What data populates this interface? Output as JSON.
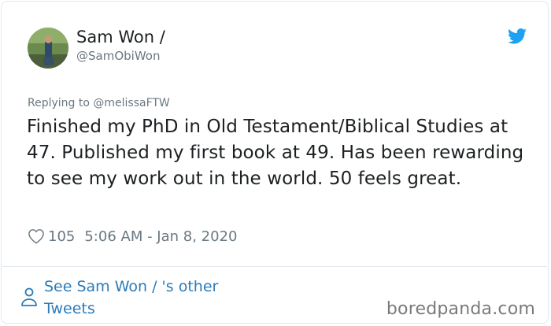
{
  "tweet": {
    "author_name": "Sam Won /",
    "author_handle": "@SamObiWon",
    "replying_to": "Replying to @melissaFTW",
    "text": "Finished my PhD in Old Testament/Biblical Studies at 47. Published my first book at 49. Has been rewarding to see my work out in the world. 50 feels great.",
    "like_count": "105",
    "timestamp": "5:06 AM - Jan 8, 2020",
    "see_more_line1": "See Sam Won / 's other",
    "see_more_line2": "Tweets"
  },
  "watermark": "boredpanda.com",
  "colors": {
    "twitter_blue": "#1da1f2",
    "link_blue": "#2b7bb9",
    "muted": "#697882",
    "border": "#e1e8ed"
  },
  "icons": [
    "twitter-bird-icon",
    "heart-icon",
    "person-icon"
  ]
}
